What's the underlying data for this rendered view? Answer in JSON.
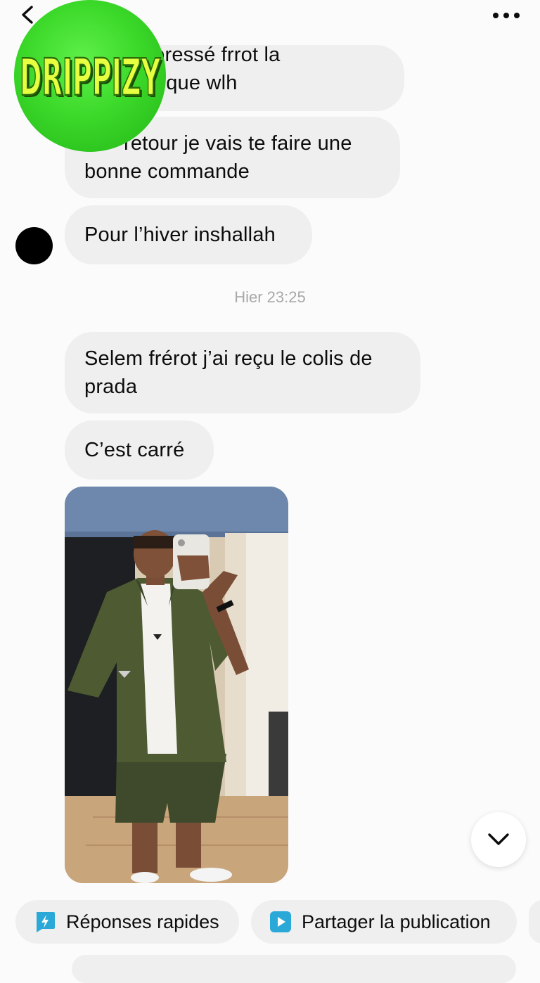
{
  "logo": {
    "text": "DRIPPIZY"
  },
  "messages": {
    "m1_line1": "un peu pressé frrot la",
    "m1_line2": "s m’as nique wlh",
    "m2_line1": "retour je vais te faire une",
    "m2_line2": "bonne commande",
    "m3": "Pour l’hiver inshallah",
    "timestamp": "Hier 23:25",
    "m4_line1": "Selem frérot j’ai reçu le colis de",
    "m4_line2": "prada",
    "m5": "C’est carré"
  },
  "quick_actions": {
    "replies": "Réponses rapides",
    "share": "Partager la publication"
  },
  "icons": {
    "back": "chevron-left-icon",
    "more": "more-dots-icon",
    "scroll": "chevron-down-icon",
    "replies": "lightning-bubble-icon",
    "share": "play-square-icon"
  },
  "colors": {
    "logo_green": "#3cd92a",
    "bubble": "#efefef",
    "accent_teal": "#2aa8d8"
  }
}
